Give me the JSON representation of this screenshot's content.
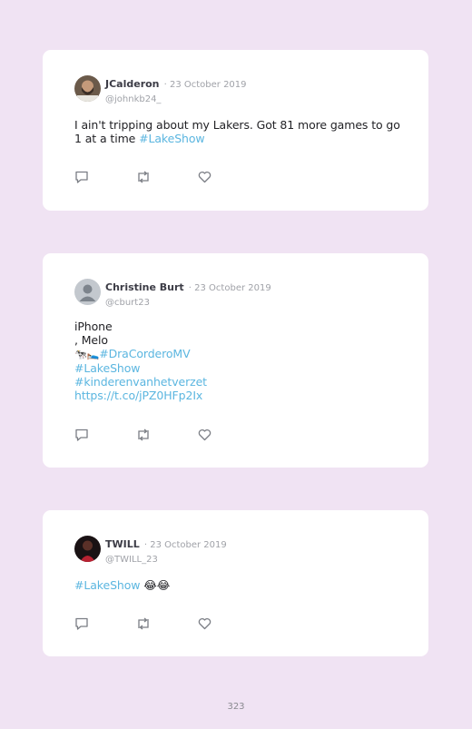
{
  "tweets": [
    {
      "name": "JCalderon",
      "date": "· 23 October 2019",
      "handle": "@johnkb24_",
      "text_plain": "I ain't tripping about my Lakers. Got 81 more games to go 1 at a time ",
      "text_link": "#LakeShow",
      "avatar_icon": "profile-photo-man-beard",
      "icons": [
        "reply-icon",
        "retweet-icon",
        "like-icon"
      ]
    },
    {
      "name": "Christine Burt",
      "date": "· 23 October 2019",
      "handle": "@cburt23",
      "lines": [
        "iPhone",
        ", Melo"
      ],
      "emoji_line": "🐄🛌",
      "links": [
        "#DraCorderoMV",
        "#LakeShow",
        "#kinderenvanhetverzet",
        "https://t.co/jPZ0HFp2Ix"
      ],
      "avatar_icon": "default-profile-silhouette",
      "icons": [
        "reply-icon",
        "retweet-icon",
        "like-icon"
      ]
    },
    {
      "name": "TWILL",
      "date": "· 23 October 2019",
      "handle": "@TWILL_23",
      "text_link": "#LakeShow",
      "text_emoji": " 😂😂",
      "avatar_icon": "profile-photo-red",
      "icons": [
        "reply-icon",
        "retweet-icon",
        "like-icon"
      ]
    }
  ],
  "page_number": "323",
  "colors": {
    "background": "#f0e3f3",
    "card": "#ffffff",
    "link": "#5bb6e0",
    "muted": "#a0a2a8",
    "icon": "#7a7d84"
  }
}
